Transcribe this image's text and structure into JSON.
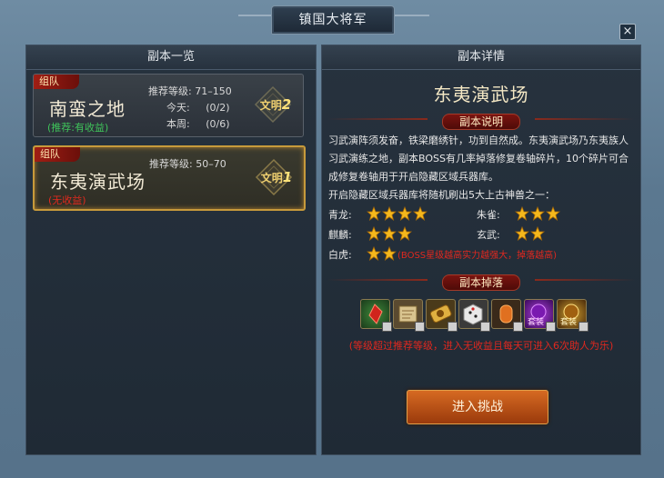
{
  "window": {
    "title": "镇国大将军",
    "close_label": "×"
  },
  "left_panel": {
    "header": "副本一览",
    "dungeons": [
      {
        "team_tag": "组队",
        "name": "南蛮之地",
        "note": "(推荐:有收益)",
        "note_color": "#3fc35a",
        "rec_label": "推荐等级:",
        "rec_value": "71–150",
        "today_label": "今天:",
        "today_value": "(0/2)",
        "week_label": "本周:",
        "week_value": "(0/6)",
        "civ_label": "文明",
        "civ_value": "2"
      },
      {
        "team_tag": "组队",
        "name": "东夷演武场",
        "note": "(无收益)",
        "note_color": "#e02a1e",
        "rec_label": "推荐等级:",
        "rec_value": "50–70",
        "civ_label": "文明",
        "civ_value": "1"
      }
    ]
  },
  "right_panel": {
    "header": "副本详情",
    "dungeon_title": "东夷演武场",
    "desc_banner": "副本说明",
    "description": "习武演阵须发奋，铁梁磨绣针，功到自然成。东夷演武场乃东夷族人习武演练之地，副本BOSS有几率掉落修复卷轴碎片，10个碎片可合成修复卷轴用于开启隐藏区域兵器库。",
    "armory_note": "开启隐藏区域兵器库将随机刷出5大上古神兽之一：",
    "beasts": [
      {
        "name": "青龙:",
        "stars": 4
      },
      {
        "name": "朱雀:",
        "stars": 3
      },
      {
        "name": "麒麟:",
        "stars": 3
      },
      {
        "name": "玄武:",
        "stars": 2
      },
      {
        "name": "白虎:",
        "stars": 2
      }
    ],
    "boss_note": "(BOSS星级越高实力越强大，掉落越高)",
    "drops_banner": "副本掉落",
    "drop_items": [
      {
        "icon": "red-crystal-icon",
        "label": ""
      },
      {
        "icon": "scroll-map-icon",
        "label": ""
      },
      {
        "icon": "golden-scroll-icon",
        "label": ""
      },
      {
        "icon": "dice-icon",
        "label": ""
      },
      {
        "icon": "orange-gem-icon",
        "label": ""
      },
      {
        "icon": "purple-package-icon",
        "label": "套装"
      },
      {
        "icon": "gold-package-icon",
        "label": "套装"
      }
    ],
    "drop_note": "(等级超过推荐等级，进入无收益且每天可进入6次助人为乐)",
    "enter_button": "进入挑战"
  },
  "colors": {
    "accent_gold": "#c79a3b",
    "warn_red": "#e0281f",
    "button_orange": "#d66a22"
  }
}
